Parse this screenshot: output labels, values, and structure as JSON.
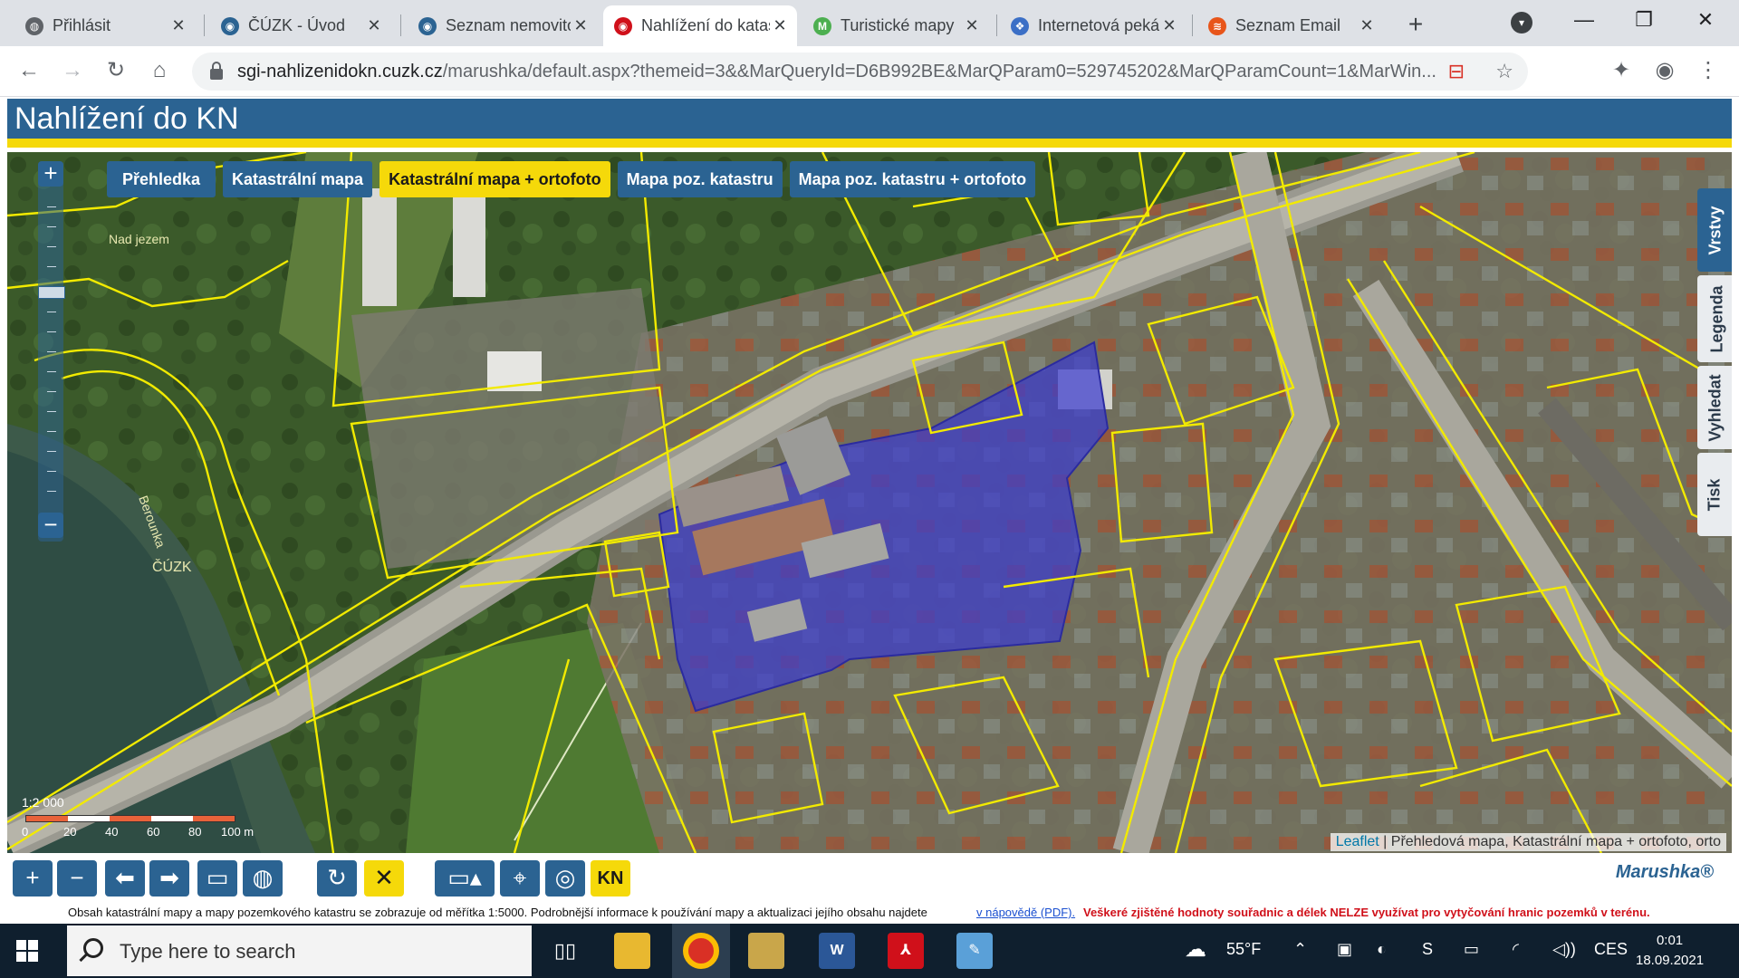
{
  "browser": {
    "tabs": [
      {
        "title": "Přihlásit",
        "icon_color": "#5f6368",
        "icon": "globe-icon"
      },
      {
        "title": "ČÚZK - Úvod",
        "icon_color": "#2b6392",
        "icon": "cuzk-icon"
      },
      {
        "title": "Seznam nemovitostí",
        "icon_color": "#2b6392",
        "icon": "cuzk-icon"
      },
      {
        "title": "Nahlížení do katastru",
        "icon_color": "#d0101a",
        "icon": "cuzk-icon",
        "active": true
      },
      {
        "title": "Turistické mapy",
        "icon_color": "#4caf50",
        "icon": "mapy-icon",
        "icon_text": "M"
      },
      {
        "title": "Internetová pekárna",
        "icon_color": "#3b6fc6",
        "icon": "web-icon"
      },
      {
        "title": "Seznam Email",
        "icon_color": "#e8551a",
        "icon": "seznam-icon"
      }
    ],
    "new_tab": "+",
    "url_host": "sgi-nahlizenidokn.cuzk.cz",
    "url_path": "/marushka/default.aspx?themeid=3&&MarQueryId=D6B992BE&MarQParam0=529745202&MarQParamCount=1&MarWin..."
  },
  "app": {
    "title": "Nahlížení do KN",
    "layer_tabs": [
      "Přehledka",
      "Katastrální mapa",
      "Katastrální mapa + ortofoto",
      "Mapa poz. katastru",
      "Mapa poz. katastru + ortofoto"
    ],
    "active_layer_tab": 2,
    "side_tabs": [
      "Vrstvy",
      "Legenda",
      "Vyhledat",
      "Tisk"
    ],
    "zoom_in": "+",
    "zoom_out": "−",
    "map_labels": [
      "Nad jezem",
      "ČÚZK",
      "Berounka"
    ],
    "scale": {
      "ratio": "1:2 000",
      "ticks": [
        "0",
        "20",
        "40",
        "60",
        "80",
        "100 m"
      ]
    },
    "attribution_link": "Leaflet",
    "attribution_text": " | Přehledová mapa, Katastrální mapa + ortofoto, orto",
    "kn_label": "KN",
    "brand": "Marushka®",
    "footnote_main": "Obsah katastrální mapy a mapy pozemkového katastru se zobrazuje od měřítka 1:5000. Podrobnější informace k používání mapy a aktualizaci jejího obsahu najdete",
    "footnote_link": "v nápovědě (PDF).",
    "footnote_warning": "Veškeré zjištěné hodnoty souřadnic a délek NELZE využívat pro vytyčování hranic pozemků v terénu."
  },
  "taskbar": {
    "search_placeholder": "Type here to search",
    "weather": "55°F",
    "language": "CES",
    "time": "0:01",
    "date": "18.09.2021"
  },
  "colors": {
    "header_blue": "#2b6392",
    "accent_yellow": "#f5d90a",
    "parcel_line": "#f2ea00",
    "selected_parcel": "#3c3ccf"
  }
}
